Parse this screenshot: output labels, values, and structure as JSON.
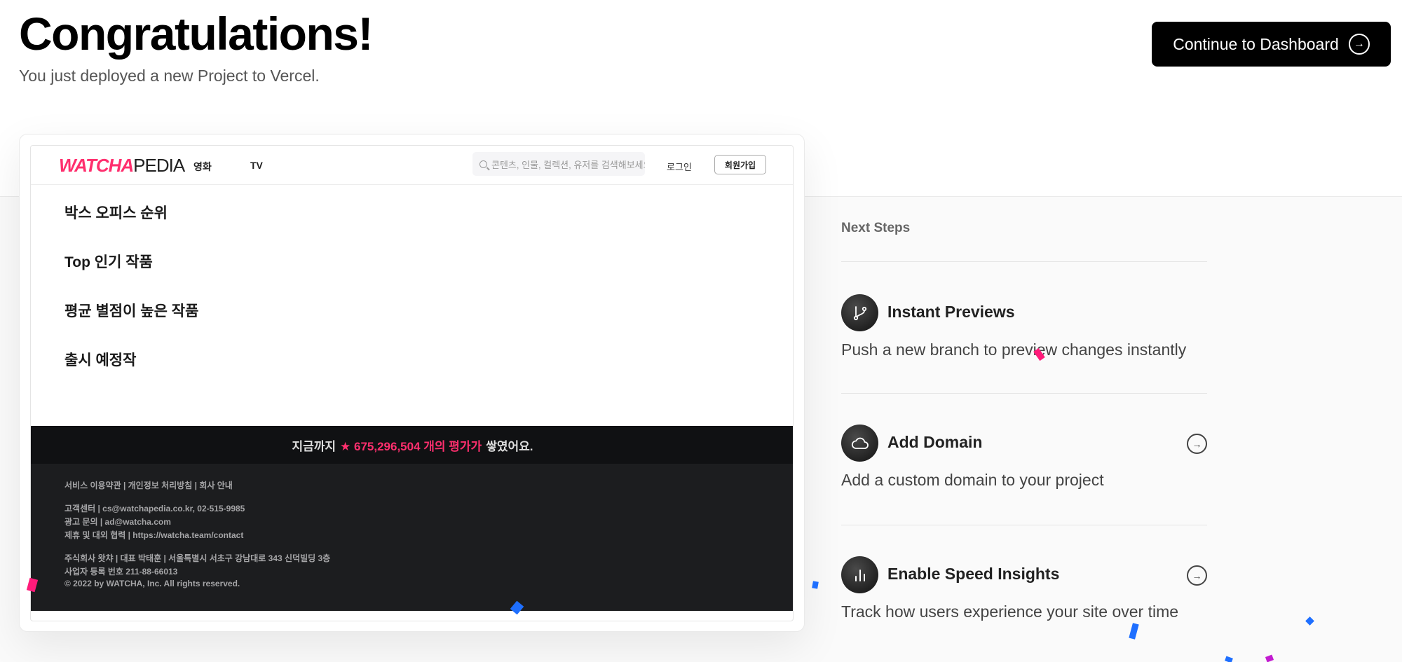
{
  "hero": {
    "title": "Congratulations!",
    "subtitle": "You just deployed a new Project to Vercel."
  },
  "cta": {
    "label": "Continue to Dashboard",
    "icon": "arrow-right-circle-icon"
  },
  "preview": {
    "logo_main": "WATCHA",
    "logo_sub": "PEDIA",
    "nav": [
      "영화",
      "TV"
    ],
    "search_placeholder": "콘텐츠, 인물, 컬렉션, 유저를 검색해보세요.",
    "login": "로그인",
    "signup": "회원가입",
    "sections": [
      "박스 오피스 순위",
      "Top 인기 작품",
      "평균 별점이 높은 작품",
      "출시 예정작"
    ],
    "rating": {
      "prefix": "지금까지",
      "highlight": "★ 675,296,504 개의 평가가",
      "suffix": "쌓였어요."
    },
    "footer": {
      "links": "서비스 이용약관 | 개인정보 처리방침 | 회사 안내",
      "contact": [
        "고객센터 | cs@watchapedia.co.kr, 02-515-9985",
        "광고 문의 | ad@watcha.com",
        "제휴 및 대외 협력 | https://watcha.team/contact"
      ],
      "company": [
        "주식회사 왓챠 | 대표 박태훈 | 서울특별시 서초구 강남대로 343 신덕빌딩 3층",
        "사업자 등록 번호 211-88-66013",
        "© 2022 by WATCHA, Inc. All rights reserved."
      ]
    },
    "accent": "#ff2f6e"
  },
  "next_steps": {
    "title": "Next Steps",
    "items": [
      {
        "title": "Instant Previews",
        "description": "Push a new branch to preview changes instantly",
        "icon": "git-branch-icon"
      },
      {
        "title": "Add Domain",
        "description": "Add a custom domain to your project",
        "icon": "cloud-icon"
      },
      {
        "title": "Enable Speed Insights",
        "description": "Track how users experience your site over time",
        "icon": "bar-chart-icon"
      }
    ]
  }
}
